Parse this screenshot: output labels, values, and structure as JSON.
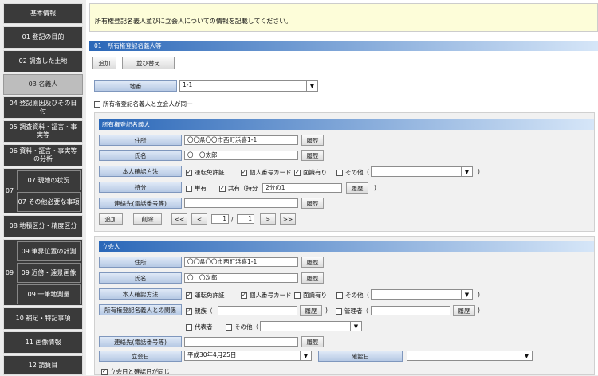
{
  "sidebar": {
    "items": [
      {
        "label": "基本情報"
      },
      {
        "label": "01 登記の目的"
      },
      {
        "label": "02 調査した土地"
      },
      {
        "label": "03 名義人"
      },
      {
        "label": "04 登記原因及びその日付"
      },
      {
        "label": "05 調査資料・証言・事実等"
      },
      {
        "label": "06 資料・証言・事実等の分析"
      },
      {
        "group": "07",
        "subs": [
          {
            "label": "07 現地の状況"
          },
          {
            "label": "07 その他必要な事項"
          }
        ]
      },
      {
        "label": "08 地積区分・精度区分"
      },
      {
        "group": "09",
        "subs": [
          {
            "label": "09 筆界位置の計測"
          },
          {
            "label": "09 近傍・遠景画像"
          },
          {
            "label": "09 一筆地測量"
          }
        ]
      },
      {
        "label": "10 補足・特記事項"
      },
      {
        "label": "11 画像情報"
      },
      {
        "label": "12 請負目"
      }
    ]
  },
  "instruction": "所有権登記名義人並びに立会人についての情報を記載してください。",
  "section_bar": "01　所有権登記名義人等",
  "toolbar": {
    "add": "追加",
    "sort": "並び替え"
  },
  "chiban": {
    "label": "地番",
    "value": "1-1"
  },
  "same_check": "所有権登記名義人と立会人が同一",
  "owner": {
    "title": "所有権登記名義人",
    "address_label": "住所",
    "address_value": "〇〇県〇〇市西町浜喜1-1",
    "address_history": "履歴",
    "name_label": "氏名",
    "name_value": "〇　〇太郎",
    "name_history": "履歴",
    "id_label": "本人確認方法",
    "id_opts": [
      "運転免許証",
      "個人番号カード",
      "面識有り",
      "その他（"
    ],
    "share_label": "持分",
    "share_opts": [
      "単有",
      "共有（持分"
    ],
    "share_value": "2分の1",
    "share_history": "履歴",
    "contact_label": "連絡先(電話番号等)",
    "contact_history": "履歴",
    "add": "追加",
    "delete": "削除",
    "pager": {
      "first": "<<",
      "prev": "<",
      "current": "1",
      "sep": "/",
      "total": "1",
      "next": ">",
      "last": ">>"
    }
  },
  "witness": {
    "title": "立会人",
    "address_label": "住所",
    "address_value": "〇〇県〇〇市西町浜喜1-1",
    "address_history": "履歴",
    "name_label": "氏名",
    "name_value": "〇　〇次郎",
    "name_history": "履歴",
    "id_label": "本人確認方法",
    "id_opts": [
      "運転免許証",
      "個人番号カード",
      "面識有り",
      "その他（"
    ],
    "relation_label": "所有権登記名義人との関係",
    "relation_opts": [
      "親族（",
      "管理者（",
      "代表者",
      "その他（"
    ],
    "relation_history": "履歴",
    "manager_history": "履歴",
    "contact_label": "連絡先(電話番号等)",
    "contact_history": "履歴",
    "date_label": "立会日",
    "date_value": "平成30年4月25日",
    "confirm_label": "確認日",
    "same_date": "立会日と確認日が同じ"
  },
  "paren": ")"
}
